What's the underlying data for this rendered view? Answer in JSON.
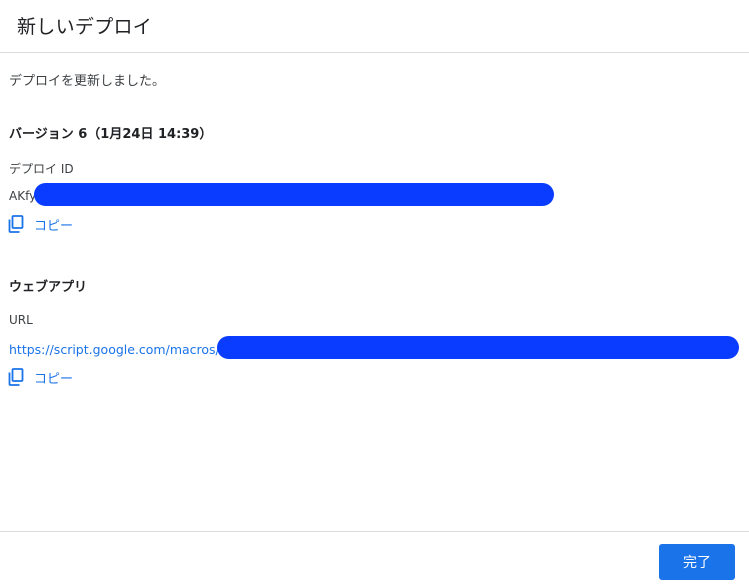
{
  "dialog": {
    "title": "新しいデプロイ"
  },
  "status": {
    "message": "デプロイを更新しました。"
  },
  "version": {
    "heading": "バージョン 6（1月24日 14:39）"
  },
  "deployment_id": {
    "label": "デプロイ ID",
    "value_prefix": "AKfy",
    "copy_label": "コピー",
    "copy_icon": "copy-icon"
  },
  "web_app": {
    "heading": "ウェブアプリ",
    "url_label": "URL",
    "url_prefix": "https://script.google.com/macros/s",
    "copy_label": "コピー",
    "copy_icon": "copy-icon"
  },
  "footer": {
    "done_label": "完了"
  },
  "colors": {
    "accent": "#1a73e8",
    "redaction": "#0a3cff",
    "divider": "#dadce0"
  }
}
